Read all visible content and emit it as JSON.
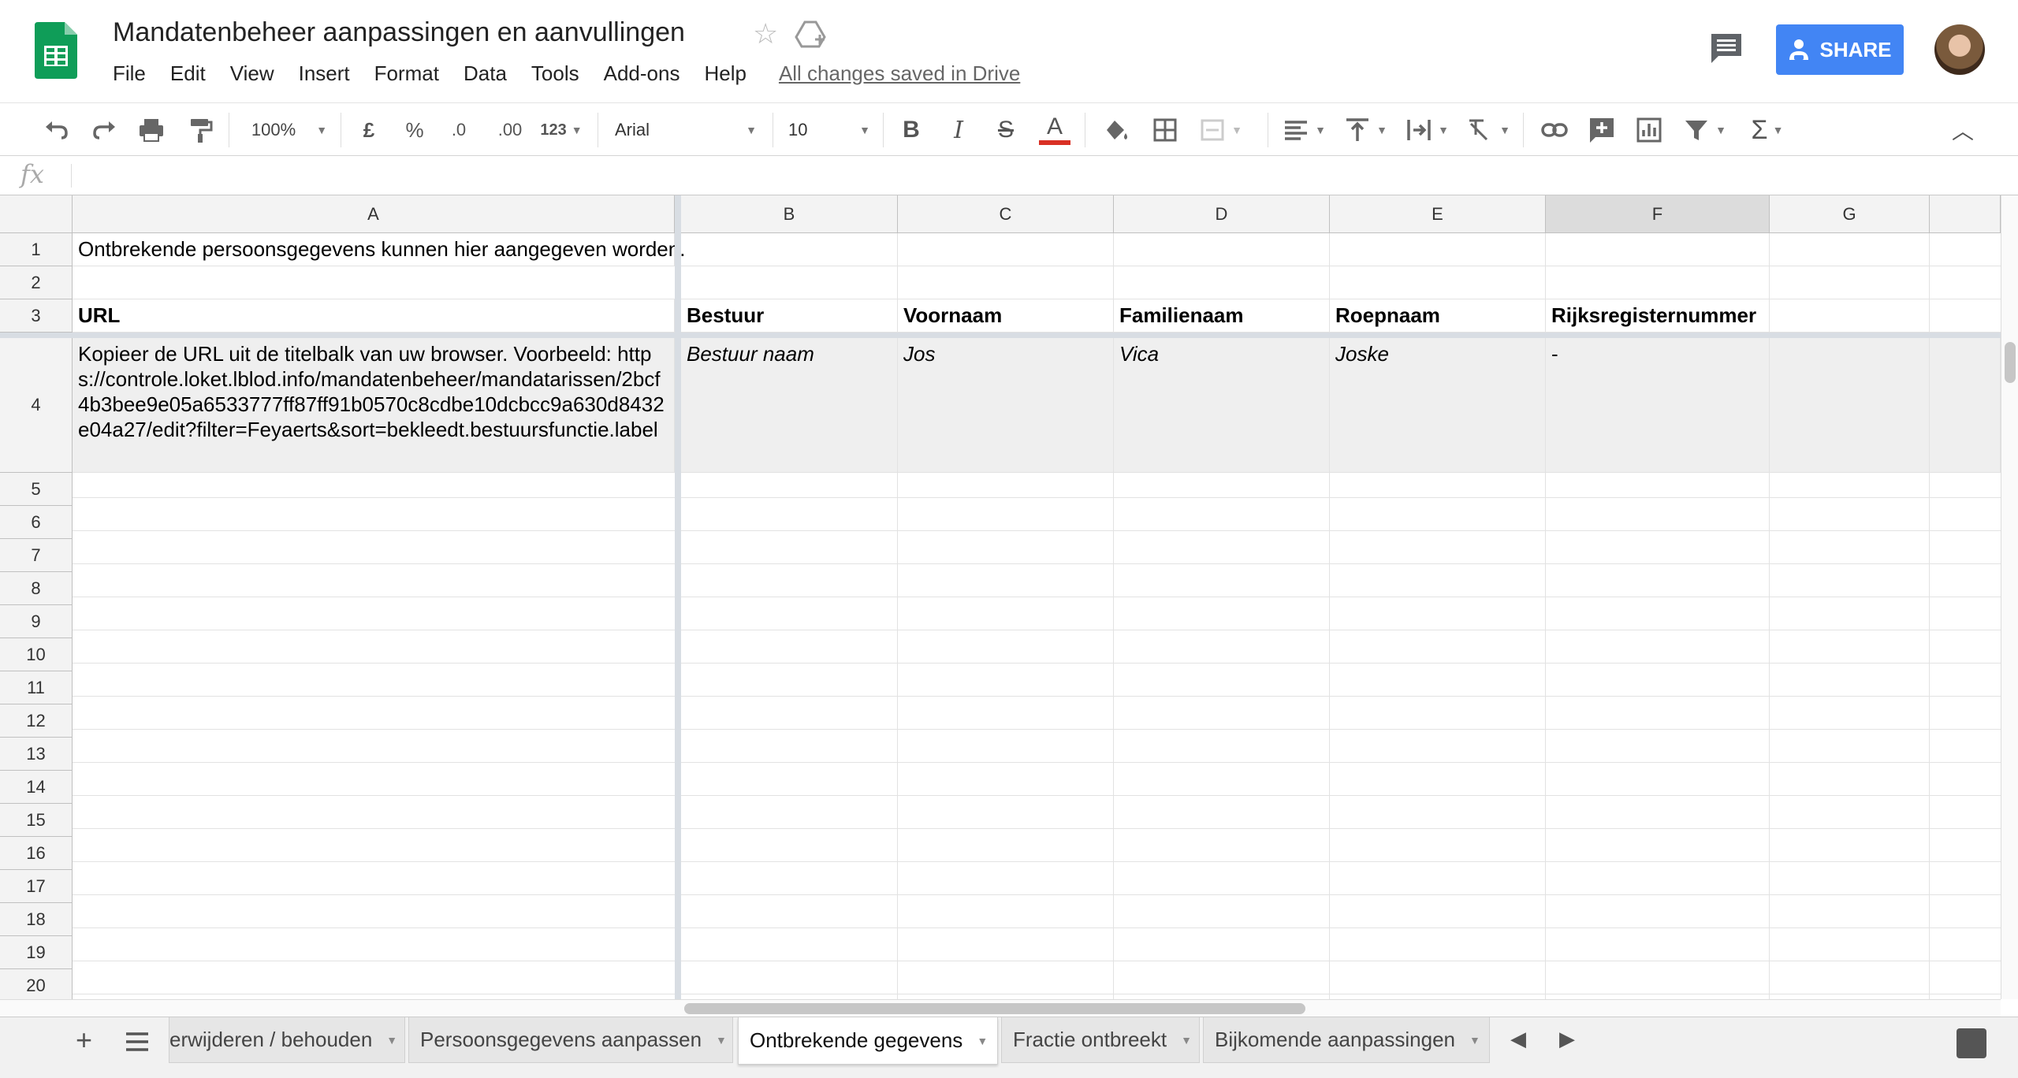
{
  "app": {
    "title": "Mandatenbeheer aanpassingen en aanvullingen",
    "save_status": "All changes saved in Drive",
    "share_label": "SHARE"
  },
  "menu": [
    "File",
    "Edit",
    "View",
    "Insert",
    "Format",
    "Data",
    "Tools",
    "Add-ons",
    "Help"
  ],
  "toolbar": {
    "zoom": "100%",
    "currency": "£",
    "percent": "%",
    "decrease_decimals": ".0",
    "increase_decimals": ".00",
    "more_formats": "123",
    "font": "Arial",
    "font_size": "10"
  },
  "formula_bar": {
    "fx_label": "fx",
    "value": ""
  },
  "columns": [
    "A",
    "B",
    "C",
    "D",
    "E",
    "F",
    "G"
  ],
  "selected_column": "F",
  "rows": [
    "1",
    "2",
    "3",
    "4",
    "5",
    "6",
    "7",
    "8",
    "9",
    "10",
    "11",
    "12",
    "13",
    "14",
    "15",
    "16",
    "17",
    "18",
    "19",
    "20"
  ],
  "cells": {
    "A1": "Ontbrekende persoonsgegevens kunnen hier aangegeven worden.",
    "A3": "URL",
    "B3": "Bestuur",
    "C3": "Voornaam",
    "D3": "Familienaam",
    "E3": "Roepnaam",
    "F3": "Rijksregisternummer",
    "A4": "Kopieer de URL uit de titelbalk van uw browser. Voorbeeld: https://controle.loket.lblod.info/mandatenbeheer/mandatarissen/2bcf4b3bee9e05a6533777ff87ff91b0570c8cdbe10dcbcc9a630d8432e04a27/edit?filter=Feyaerts&sort=bekleedt.bestuursfunctie.label",
    "B4": "Bestuur naam",
    "C4": "Jos",
    "D4": "Vica",
    "E4": "Joske",
    "F4": "-"
  },
  "sheets": [
    {
      "label": "erwijderen / behouden",
      "active": false
    },
    {
      "label": "Persoonsgegevens aanpassen",
      "active": false
    },
    {
      "label": "Ontbrekende gegevens",
      "active": true
    },
    {
      "label": "Fractie ontbreekt",
      "active": false
    },
    {
      "label": "Bijkomende aanpassingen",
      "active": false
    }
  ],
  "colors": {
    "brand_green": "#0f9d58",
    "share_blue": "#4285f4",
    "text_color_underline": "#d93025"
  }
}
